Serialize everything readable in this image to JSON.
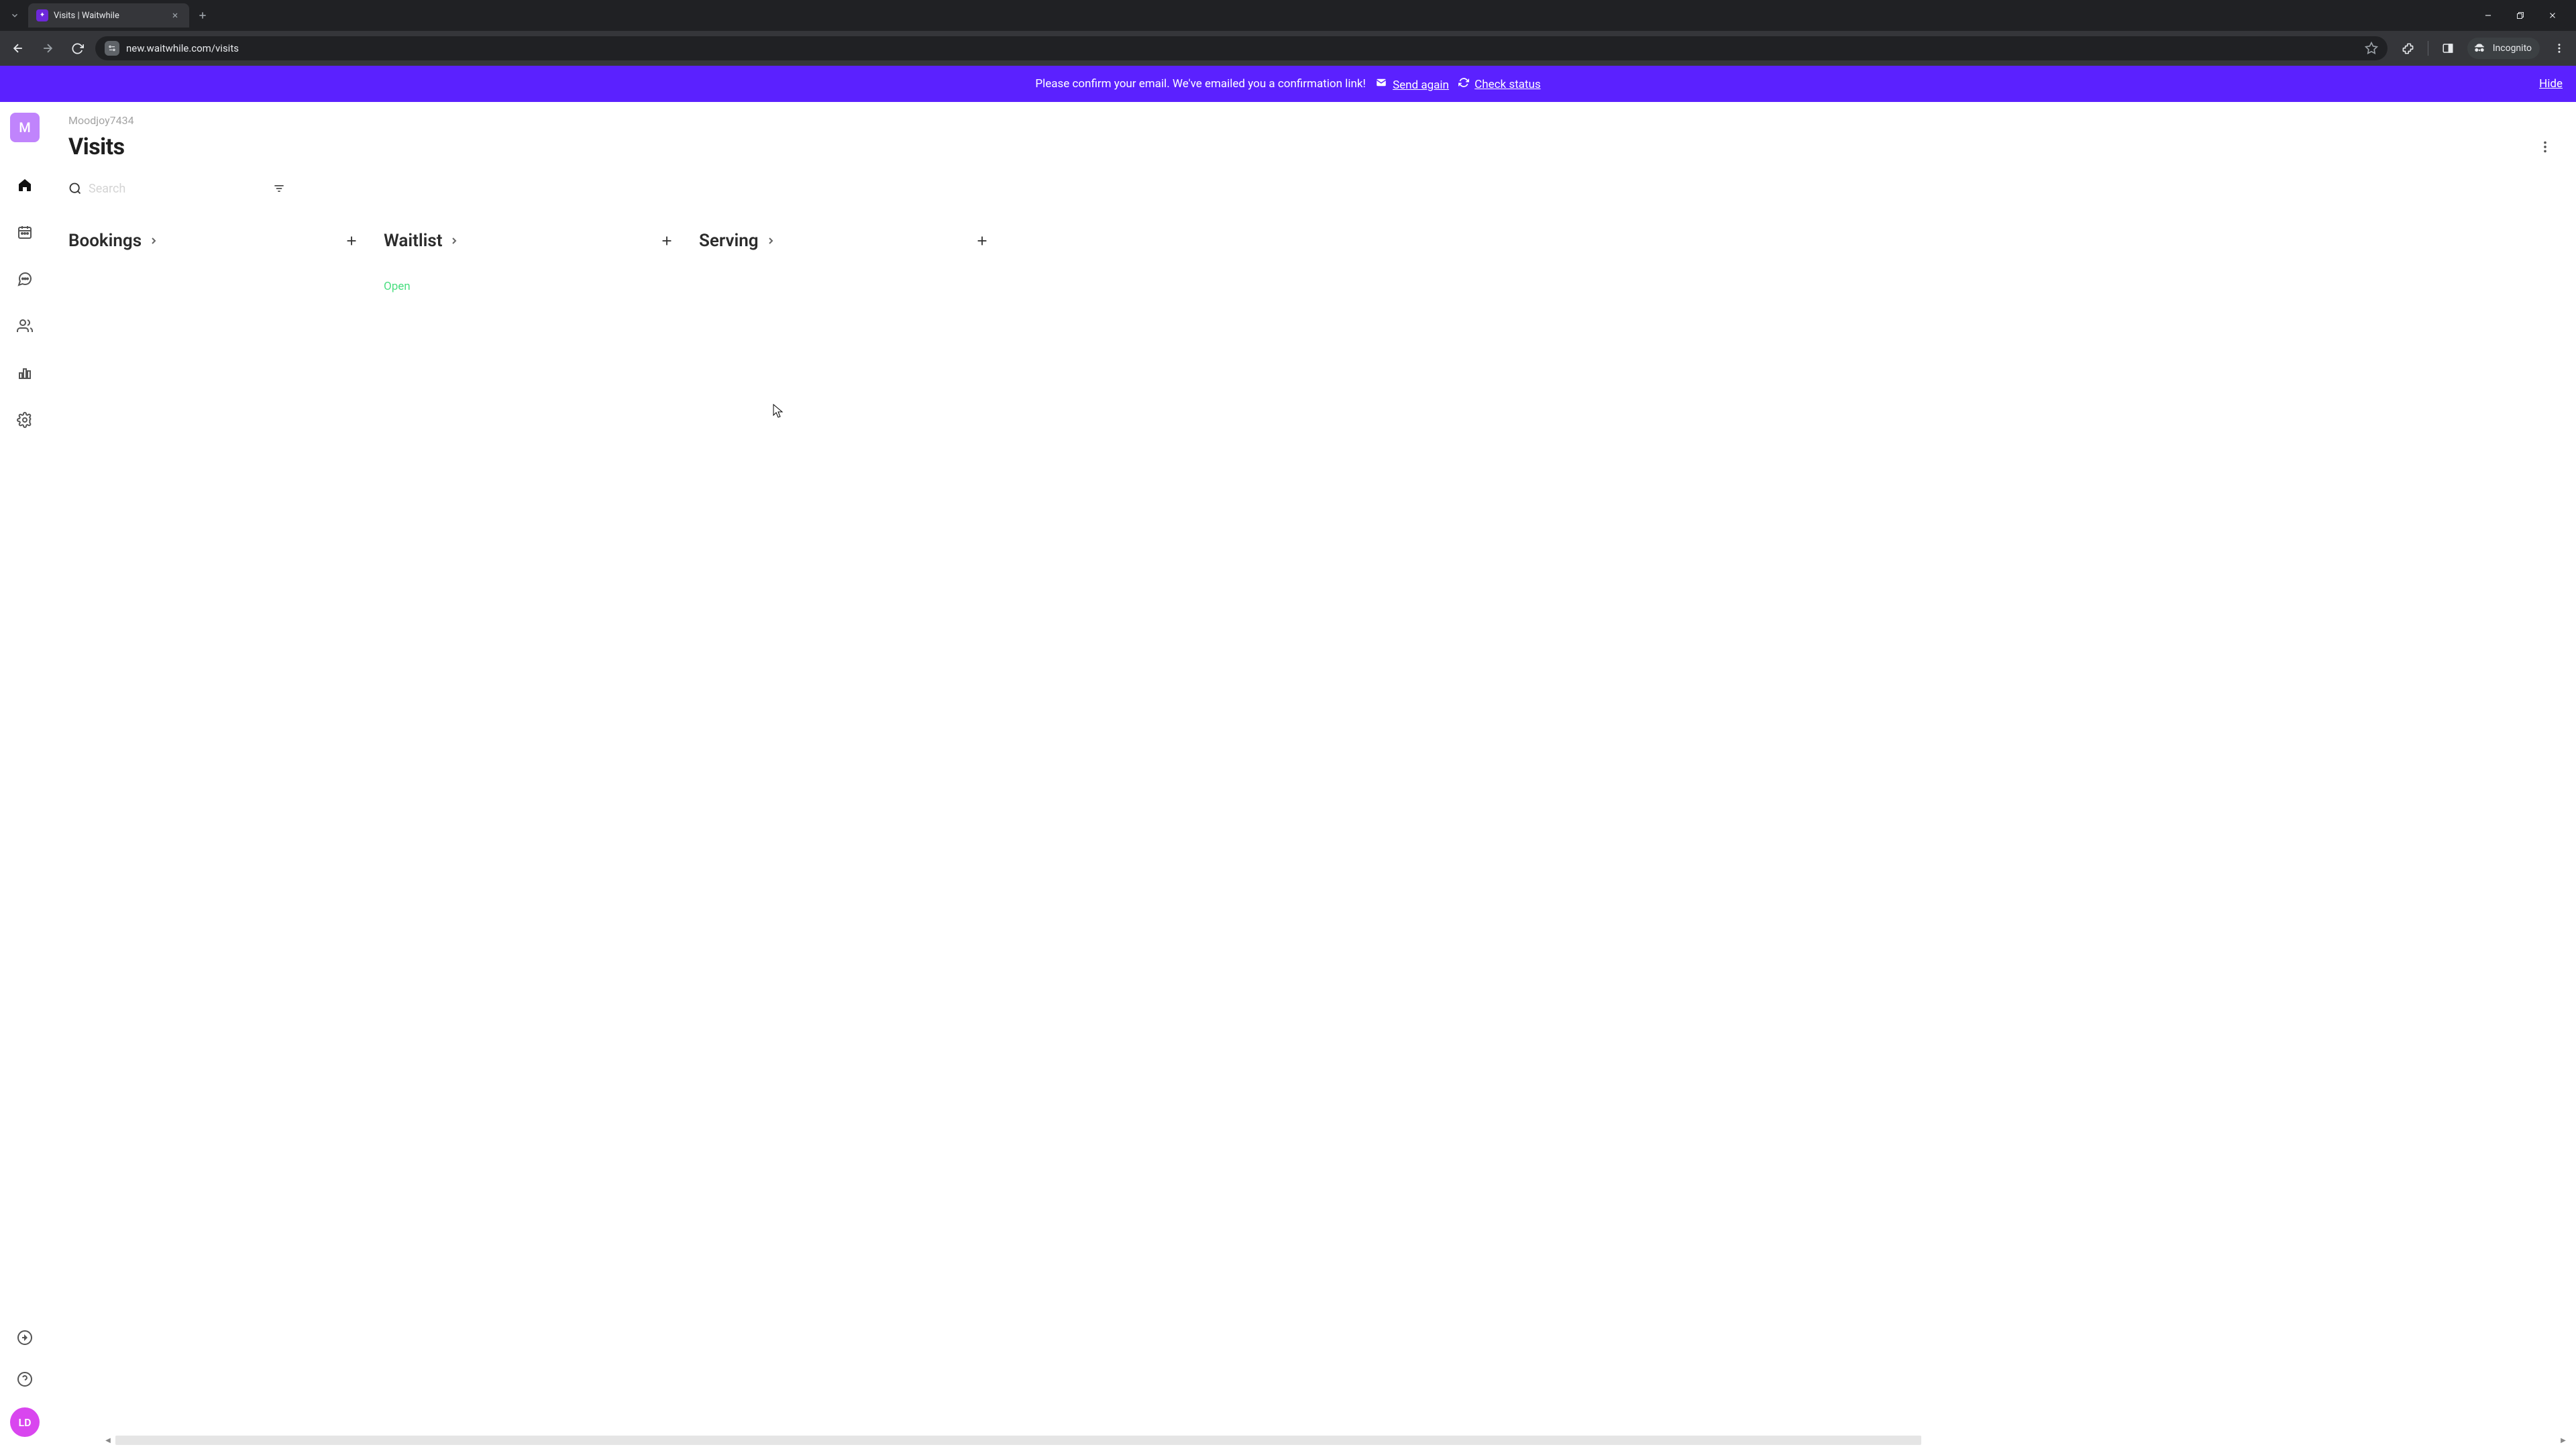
{
  "browser": {
    "tab_title": "Visits | Waitwhile",
    "url": "new.waitwhile.com/visits",
    "incognito_label": "Incognito"
  },
  "banner": {
    "message": "Please confirm your email. We've emailed you a confirmation link!",
    "send_again": "Send again",
    "check_status": "Check status",
    "hide": "Hide"
  },
  "sidebar": {
    "org_initial": "M",
    "user_initials": "LD"
  },
  "main": {
    "org_name": "Moodjoy7434",
    "page_title": "Visits",
    "search_placeholder": "Search",
    "columns": [
      {
        "title": "Bookings"
      },
      {
        "title": "Waitlist",
        "status": "Open"
      },
      {
        "title": "Serving"
      }
    ]
  }
}
